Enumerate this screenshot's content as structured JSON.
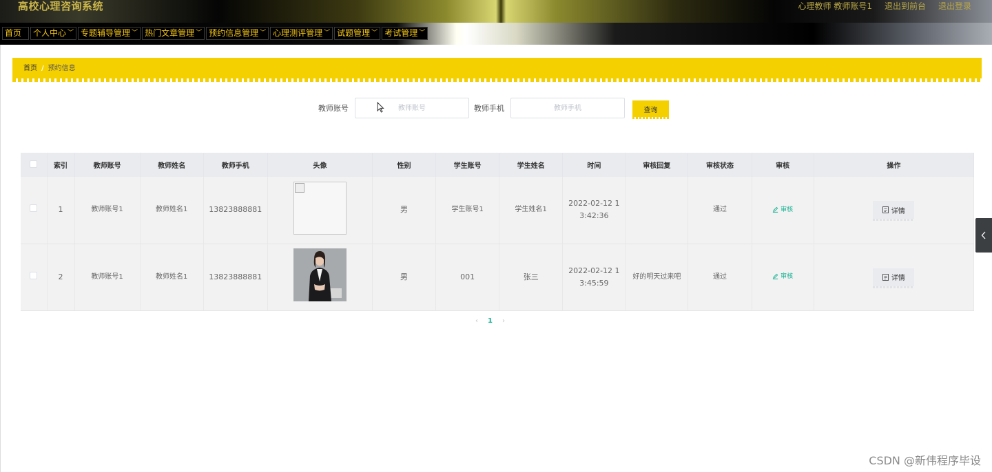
{
  "header": {
    "title": "高校心理咨询系统",
    "user_label": "心理教师 教师账号1",
    "to_front": "退出到前台",
    "logout": "退出登录"
  },
  "nav": {
    "items": [
      {
        "label": "首页",
        "has_dropdown": false
      },
      {
        "label": "个人中心",
        "has_dropdown": true
      },
      {
        "label": "专题辅导管理",
        "has_dropdown": true
      },
      {
        "label": "热门文章管理",
        "has_dropdown": true
      },
      {
        "label": "预约信息管理",
        "has_dropdown": true
      },
      {
        "label": "心理测评管理",
        "has_dropdown": true
      },
      {
        "label": "试题管理",
        "has_dropdown": true
      },
      {
        "label": "考试管理",
        "has_dropdown": true
      }
    ]
  },
  "breadcrumb": {
    "home": "首页",
    "sep": "/",
    "current": "预约信息"
  },
  "search": {
    "teacher_account_label": "教师账号",
    "teacher_account_placeholder": "教师账号",
    "teacher_account_value": "",
    "teacher_phone_label": "教师手机",
    "teacher_phone_placeholder": "教师手机",
    "teacher_phone_value": "",
    "query_button": "查询"
  },
  "table": {
    "headers": [
      "索引",
      "教师账号",
      "教师姓名",
      "教师手机",
      "头像",
      "性别",
      "学生账号",
      "学生姓名",
      "时间",
      "审核回复",
      "审核状态",
      "审核",
      "操作"
    ],
    "rows": [
      {
        "index": "1",
        "teacher_account": "教师账号1",
        "teacher_name": "教师姓名1",
        "teacher_phone": "13823888881",
        "avatar": "broken",
        "gender": "男",
        "student_account": "学生账号1",
        "student_name": "学生姓名1",
        "time_line1": "2022-02-12 1",
        "time_line2": "3:42:36",
        "reply": "",
        "status": "通过",
        "review_label": "审核",
        "detail_label": "详情"
      },
      {
        "index": "2",
        "teacher_account": "教师账号1",
        "teacher_name": "教师姓名1",
        "teacher_phone": "13823888881",
        "avatar": "photo",
        "gender": "男",
        "student_account": "001",
        "student_name": "张三",
        "time_line1": "2022-02-12 1",
        "time_line2": "3:45:59",
        "reply": "好的明天过来吧",
        "status": "通过",
        "review_label": "审核",
        "detail_label": "详情"
      }
    ]
  },
  "pagination": {
    "prev": "‹",
    "current": "1",
    "next": "›"
  },
  "watermark": "CSDN @新伟程序毕设",
  "colors": {
    "accent_yellow": "#f5d000",
    "nav_text": "#f5c518",
    "link_green": "#1ab394"
  }
}
